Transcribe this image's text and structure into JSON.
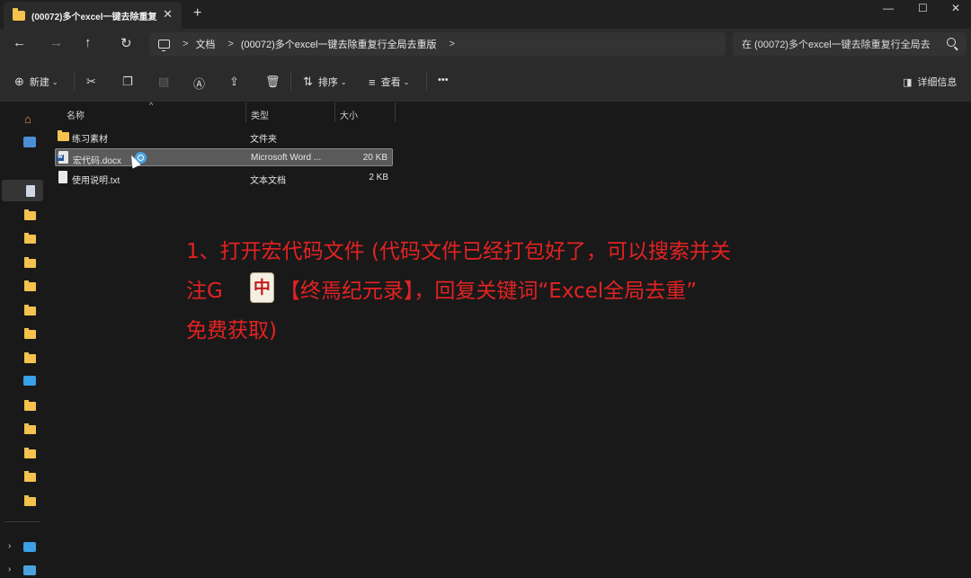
{
  "window": {
    "tab_title": "(00072)多个excel一键去除重复",
    "tab_close": "✕",
    "new_tab": "+",
    "minimize": "—",
    "maximize": "☐",
    "close": "✕"
  },
  "nav": {
    "back": "←",
    "forward": "→",
    "up": "↑",
    "refresh": "↻",
    "breadcrumb": [
      "文档",
      "(00072)多个excel一键去除重复行全局去重版"
    ],
    "chevron": ">",
    "search_placeholder": "在 (00072)多个excel一键去除重复行全局去"
  },
  "toolbar": {
    "new_label": "新建",
    "sort_label": "排序",
    "view_label": "查看",
    "more": "•••",
    "details_label": "详细信息"
  },
  "columns": {
    "name": "名称",
    "type": "类型",
    "size": "大小"
  },
  "files": [
    {
      "name": "练习素材",
      "type": "文件夹",
      "size": "",
      "icon": "folder-icon"
    },
    {
      "name": "宏代码.docx",
      "type": "Microsoft Word ...",
      "size": "20 KB",
      "icon": "word-doc-icon",
      "selected": true
    },
    {
      "name": "使用说明.txt",
      "type": "文本文档",
      "size": "2 KB",
      "icon": "text-file-icon"
    }
  ],
  "annotation": {
    "line1": "1、打开宏代码文件 (代码文件已经打包好了，可以搜索并关",
    "line2_a": "注G",
    "line2_b": "【终焉纪元录】，回复关键词“Excel全局去重”",
    "line3": "免费获取)",
    "color": "#e32222"
  },
  "colors": {
    "folder": "#f4c24d",
    "background": "#191919",
    "chrome": "#2b2b2b"
  }
}
